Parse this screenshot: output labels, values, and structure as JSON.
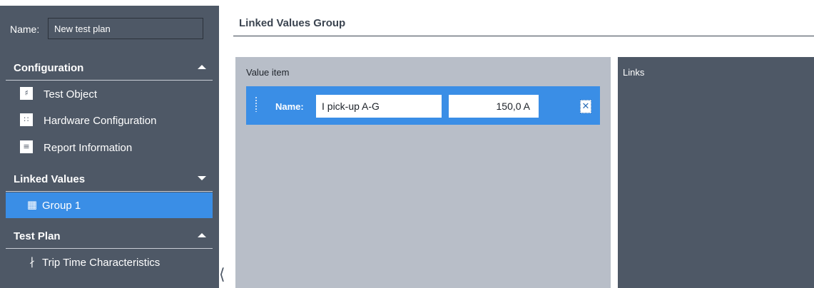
{
  "sidebar": {
    "name_label": "Name:",
    "name_value": "New test plan",
    "sections": {
      "configuration": {
        "title": "Configuration",
        "items": [
          {
            "label": "Test Object",
            "icon": "test-object-icon"
          },
          {
            "label": "Hardware Configuration",
            "icon": "hardware-configuration-icon"
          },
          {
            "label": "Report Information",
            "icon": "report-information-icon"
          }
        ]
      },
      "linked_values": {
        "title": "Linked Values",
        "items": [
          {
            "label": "Group 1",
            "icon": "group-icon",
            "selected": true
          }
        ]
      },
      "test_plan": {
        "title": "Test Plan",
        "items": [
          {
            "label": "Trip Time Characteristics",
            "icon": "trip-time-characteristics-icon"
          }
        ]
      }
    }
  },
  "main": {
    "title": "Linked Values Group",
    "value_panel": {
      "label": "Value item",
      "rows": [
        {
          "name_label": "Name:",
          "name_value": "I pick-up A-G",
          "value": "150,0 A"
        }
      ]
    },
    "links_panel": {
      "label": "Links"
    }
  },
  "colors": {
    "sidebar_bg": "#4e5866",
    "accent": "#3a8ee6",
    "value_panel_bg": "#b8bec8",
    "links_panel_bg": "#4e5866"
  }
}
